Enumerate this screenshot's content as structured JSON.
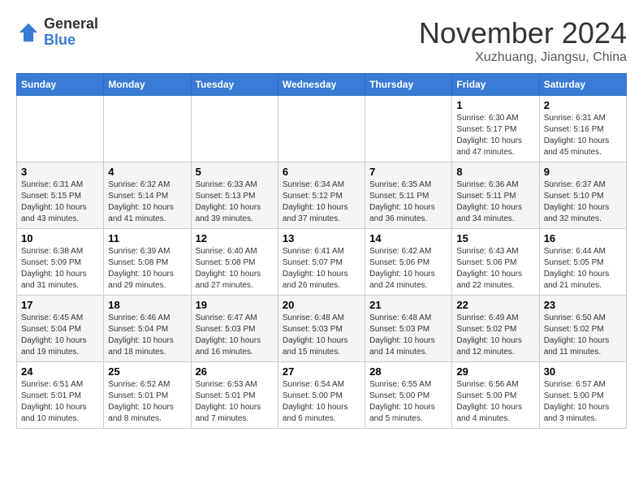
{
  "logo": {
    "general": "General",
    "blue": "Blue"
  },
  "title": "November 2024",
  "subtitle": "Xuzhuang, Jiangsu, China",
  "weekdays": [
    "Sunday",
    "Monday",
    "Tuesday",
    "Wednesday",
    "Thursday",
    "Friday",
    "Saturday"
  ],
  "weeks": [
    [
      {
        "day": "",
        "info": ""
      },
      {
        "day": "",
        "info": ""
      },
      {
        "day": "",
        "info": ""
      },
      {
        "day": "",
        "info": ""
      },
      {
        "day": "",
        "info": ""
      },
      {
        "day": "1",
        "info": "Sunrise: 6:30 AM\nSunset: 5:17 PM\nDaylight: 10 hours and 47 minutes."
      },
      {
        "day": "2",
        "info": "Sunrise: 6:31 AM\nSunset: 5:16 PM\nDaylight: 10 hours and 45 minutes."
      }
    ],
    [
      {
        "day": "3",
        "info": "Sunrise: 6:31 AM\nSunset: 5:15 PM\nDaylight: 10 hours and 43 minutes."
      },
      {
        "day": "4",
        "info": "Sunrise: 6:32 AM\nSunset: 5:14 PM\nDaylight: 10 hours and 41 minutes."
      },
      {
        "day": "5",
        "info": "Sunrise: 6:33 AM\nSunset: 5:13 PM\nDaylight: 10 hours and 39 minutes."
      },
      {
        "day": "6",
        "info": "Sunrise: 6:34 AM\nSunset: 5:12 PM\nDaylight: 10 hours and 37 minutes."
      },
      {
        "day": "7",
        "info": "Sunrise: 6:35 AM\nSunset: 5:11 PM\nDaylight: 10 hours and 36 minutes."
      },
      {
        "day": "8",
        "info": "Sunrise: 6:36 AM\nSunset: 5:11 PM\nDaylight: 10 hours and 34 minutes."
      },
      {
        "day": "9",
        "info": "Sunrise: 6:37 AM\nSunset: 5:10 PM\nDaylight: 10 hours and 32 minutes."
      }
    ],
    [
      {
        "day": "10",
        "info": "Sunrise: 6:38 AM\nSunset: 5:09 PM\nDaylight: 10 hours and 31 minutes."
      },
      {
        "day": "11",
        "info": "Sunrise: 6:39 AM\nSunset: 5:08 PM\nDaylight: 10 hours and 29 minutes."
      },
      {
        "day": "12",
        "info": "Sunrise: 6:40 AM\nSunset: 5:08 PM\nDaylight: 10 hours and 27 minutes."
      },
      {
        "day": "13",
        "info": "Sunrise: 6:41 AM\nSunset: 5:07 PM\nDaylight: 10 hours and 26 minutes."
      },
      {
        "day": "14",
        "info": "Sunrise: 6:42 AM\nSunset: 5:06 PM\nDaylight: 10 hours and 24 minutes."
      },
      {
        "day": "15",
        "info": "Sunrise: 6:43 AM\nSunset: 5:06 PM\nDaylight: 10 hours and 22 minutes."
      },
      {
        "day": "16",
        "info": "Sunrise: 6:44 AM\nSunset: 5:05 PM\nDaylight: 10 hours and 21 minutes."
      }
    ],
    [
      {
        "day": "17",
        "info": "Sunrise: 6:45 AM\nSunset: 5:04 PM\nDaylight: 10 hours and 19 minutes."
      },
      {
        "day": "18",
        "info": "Sunrise: 6:46 AM\nSunset: 5:04 PM\nDaylight: 10 hours and 18 minutes."
      },
      {
        "day": "19",
        "info": "Sunrise: 6:47 AM\nSunset: 5:03 PM\nDaylight: 10 hours and 16 minutes."
      },
      {
        "day": "20",
        "info": "Sunrise: 6:48 AM\nSunset: 5:03 PM\nDaylight: 10 hours and 15 minutes."
      },
      {
        "day": "21",
        "info": "Sunrise: 6:48 AM\nSunset: 5:03 PM\nDaylight: 10 hours and 14 minutes."
      },
      {
        "day": "22",
        "info": "Sunrise: 6:49 AM\nSunset: 5:02 PM\nDaylight: 10 hours and 12 minutes."
      },
      {
        "day": "23",
        "info": "Sunrise: 6:50 AM\nSunset: 5:02 PM\nDaylight: 10 hours and 11 minutes."
      }
    ],
    [
      {
        "day": "24",
        "info": "Sunrise: 6:51 AM\nSunset: 5:01 PM\nDaylight: 10 hours and 10 minutes."
      },
      {
        "day": "25",
        "info": "Sunrise: 6:52 AM\nSunset: 5:01 PM\nDaylight: 10 hours and 8 minutes."
      },
      {
        "day": "26",
        "info": "Sunrise: 6:53 AM\nSunset: 5:01 PM\nDaylight: 10 hours and 7 minutes."
      },
      {
        "day": "27",
        "info": "Sunrise: 6:54 AM\nSunset: 5:00 PM\nDaylight: 10 hours and 6 minutes."
      },
      {
        "day": "28",
        "info": "Sunrise: 6:55 AM\nSunset: 5:00 PM\nDaylight: 10 hours and 5 minutes."
      },
      {
        "day": "29",
        "info": "Sunrise: 6:56 AM\nSunset: 5:00 PM\nDaylight: 10 hours and 4 minutes."
      },
      {
        "day": "30",
        "info": "Sunrise: 6:57 AM\nSunset: 5:00 PM\nDaylight: 10 hours and 3 minutes."
      }
    ]
  ]
}
